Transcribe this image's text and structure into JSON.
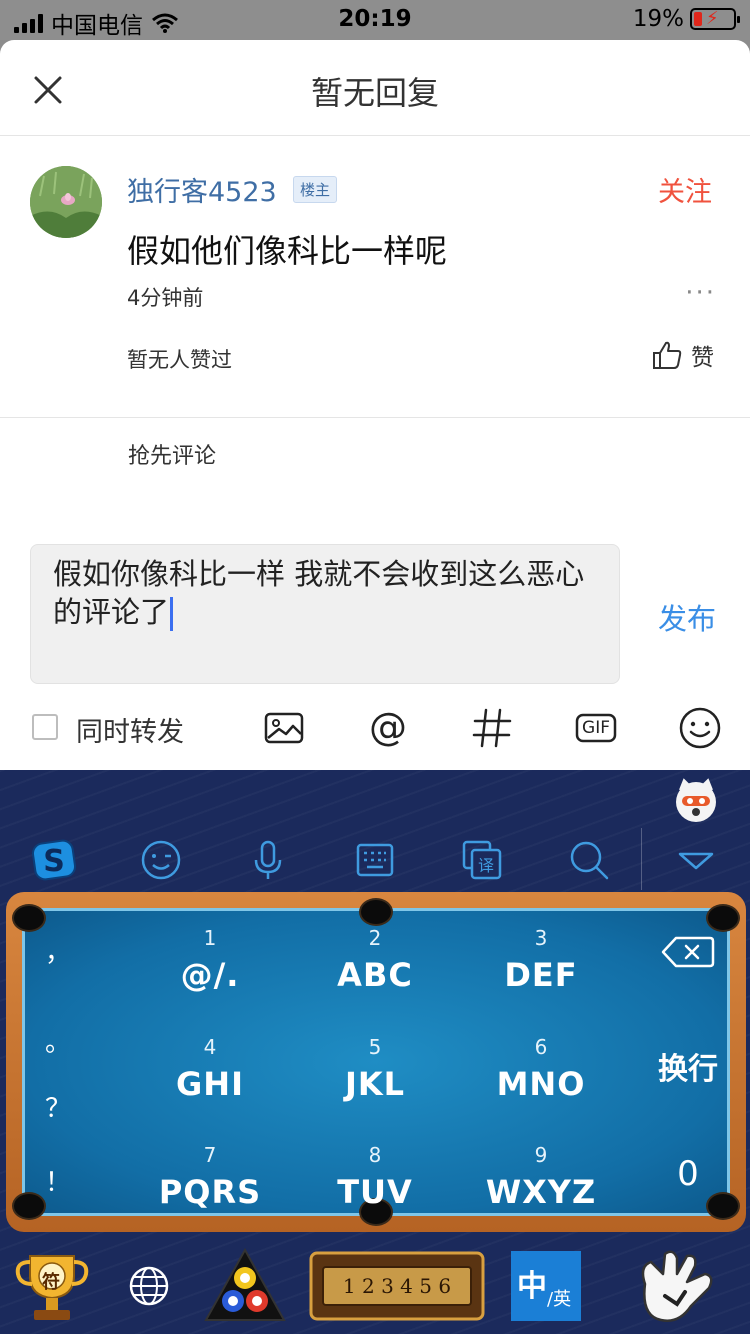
{
  "status_bar": {
    "carrier": "中国电信",
    "time": "20:19",
    "battery": "19%"
  },
  "header": {
    "title": "暂无回复"
  },
  "post": {
    "username": "独行客4523",
    "badge": "楼主",
    "follow": "关注",
    "text": "假如他们像科比一样呢",
    "time": "4分钟前",
    "more": "···",
    "likes_text": "暂无人赞过",
    "like_label": "赞"
  },
  "comments": {
    "first_prompt": "抢先评论"
  },
  "composer": {
    "text": "假如你像科比一样 我就不会收到这么恶心的评论了",
    "publish": "发布",
    "repost_label": "同时转发",
    "repost_checked": false,
    "gif_label": "GIF"
  },
  "keyboard": {
    "punctuation": [
      "，",
      "。",
      "？",
      "！"
    ],
    "keys": [
      {
        "num": "1",
        "letters": "@/."
      },
      {
        "num": "2",
        "letters": "ABC"
      },
      {
        "num": "3",
        "letters": "DEF"
      },
      {
        "num": "4",
        "letters": "GHI"
      },
      {
        "num": "5",
        "letters": "JKL"
      },
      {
        "num": "6",
        "letters": "MNO"
      },
      {
        "num": "7",
        "letters": "PQRS"
      },
      {
        "num": "8",
        "letters": "TUV"
      },
      {
        "num": "9",
        "letters": "WXYZ"
      }
    ],
    "enter": "换行",
    "zero": "0",
    "bottom": {
      "symbols_label": "符",
      "numbers_label": "1 2 3 4 5 6",
      "lang_main": "中",
      "lang_sub": "/英"
    }
  },
  "colors": {
    "link_blue": "#3f6ea5",
    "follow_red": "#f0523e",
    "publish_blue": "#3a8ee6",
    "keyboard_bg": "#1b2a5c"
  }
}
